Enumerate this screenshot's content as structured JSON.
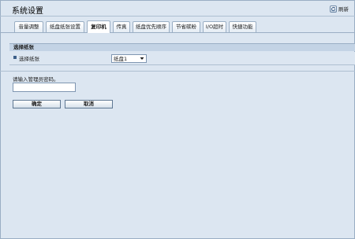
{
  "header": {
    "title": "系统设置",
    "refresh_label": "刷新"
  },
  "tabs": [
    {
      "label": "音量调整",
      "active": false
    },
    {
      "label": "纸盘纸张设置",
      "active": false
    },
    {
      "label": "复印机",
      "active": true
    },
    {
      "label": "传真",
      "active": false
    },
    {
      "label": "纸盘优先顺序",
      "active": false
    },
    {
      "label": "节省碳粉",
      "active": false
    },
    {
      "label": "I/O超时",
      "active": false
    },
    {
      "label": "快捷功能",
      "active": false
    }
  ],
  "section": {
    "title": "选择纸张",
    "rows": [
      {
        "label": "选择纸张",
        "value": "纸盘1"
      }
    ]
  },
  "password": {
    "prompt": "请输入管理员密码。",
    "value": ""
  },
  "actions": {
    "ok_label": "确定",
    "cancel_label": "取消"
  },
  "colors": {
    "background": "#dce6f1",
    "section_header": "#c3d3e5",
    "bullet": "#3d5f89"
  },
  "icons": {
    "refresh": "refresh-icon",
    "dropdown": "chevron-down-icon"
  }
}
